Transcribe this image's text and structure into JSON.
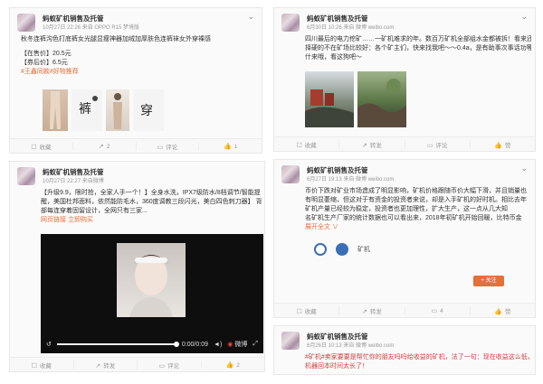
{
  "author": "蚂蚁矿机销售及托管",
  "posts": [
    {
      "meta": "10月27日 22:26 来自 OPPO R15 梦境版",
      "lines": [
        "秋冬连裤沟色打底裤女光腿显瘦神器加绒加厚肤色连裤袜女外穿裸感"
      ],
      "price_now": "【在售价】20.5元",
      "price_coupon": "【券后价】6.5元",
      "link": "#王鑫同款#好物推荐",
      "actions": [
        {
          "icon": "share-icon",
          "label": "收藏"
        },
        {
          "icon": "forward-icon",
          "label": "2"
        },
        {
          "icon": "comment-icon",
          "label": "评论"
        },
        {
          "icon": "like-icon",
          "label": "1"
        }
      ]
    },
    {
      "meta": "6月30日 10:26 来自 微博 weibo.com",
      "lines": [
        "四川最后的电力挖矿……一矿机难求的年。数百万矿机全部组水金都被拆！看来还是选",
        "择硬的不在矿场比较好：各个矿主们，快来找我吧～～0.4a，是有助事次事话功等",
        "什来哦，看这狗吧～"
      ],
      "actions": [
        {
          "icon": "share-icon",
          "label": "收藏"
        },
        {
          "icon": "forward-icon",
          "label": "转发"
        },
        {
          "icon": "comment-icon",
          "label": "评论"
        },
        {
          "icon": "like-icon",
          "label": "赞"
        }
      ]
    },
    {
      "meta": "10月27日 22:27 来自微博",
      "lines": [
        "【升级9.9，限时抢，全家人手一个！】全身水洗，IPX7级防水/8档调节/智能提",
        "醒，美国杜邦面料，依然能防毛水，360度调教三段闪光，美白四色刺刀器】 背",
        "部每连穿着固留设计，全网只有三家..."
      ],
      "link": "网页链接 立即购买",
      "video_time": "0:00/0:09",
      "video_brand": "微博",
      "actions": [
        {
          "icon": "share-icon",
          "label": "收藏"
        },
        {
          "icon": "forward-icon",
          "label": "转发"
        },
        {
          "icon": "comment-icon",
          "label": "评论"
        },
        {
          "icon": "like-icon",
          "label": "2"
        }
      ]
    },
    {
      "meta": "6月27日 19:13 来自 微博 weibo.com",
      "lines": [
        "币价下跌对矿业市场造成了明显影响，矿机价格跟随币价大幅下滑，并且销量也",
        "有明显萎缩，但这对于有资金的投资者来说，却是入手矿机的好时机。相比去年",
        "矿机产量已经较为稳定，投资者也更加理性，扩大生产，这一点从几大知",
        "名矿机生产厂家的统计数据也可以看出来，2018年初矿机开始回暖，比特币金"
      ],
      "more": "展开全文 ∨",
      "tags": [
        "矿机"
      ],
      "badge": "+ 关注",
      "actions": [
        {
          "icon": "share-icon",
          "label": "收藏"
        },
        {
          "icon": "forward-icon",
          "label": "转发"
        },
        {
          "icon": "comment-icon",
          "label": "4"
        },
        {
          "icon": "like-icon",
          "label": "赞"
        }
      ]
    },
    {
      "meta": "6月26日 10:13 来自 微博 weibo.com",
      "lines": [
        "#矿机#卖家要要是帮忙你的朋友吗吗给收益的矿机，法了一句：现在收益这么低，",
        "机器回本时间太长了！"
      ]
    }
  ],
  "colors": {
    "accent": "#e4703a",
    "red": "#d23c3c"
  }
}
